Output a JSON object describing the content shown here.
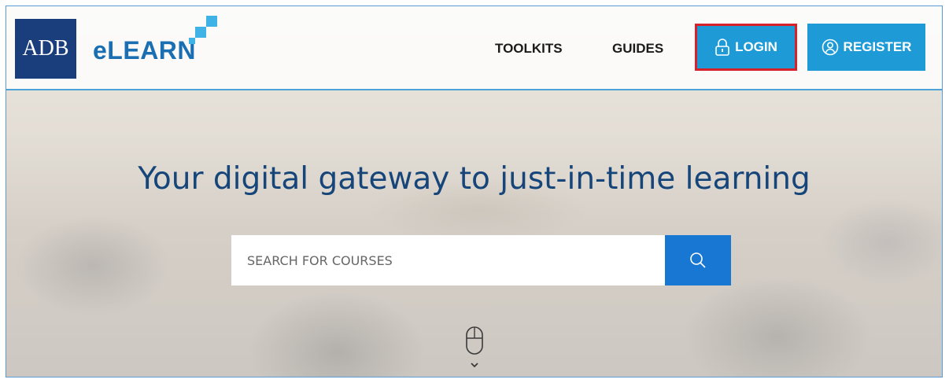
{
  "brand": {
    "logo_text": "ADB",
    "product_name": "eLEARN",
    "logo_bg_color": "#1a3d7c",
    "accent_color": "#3fb3e5"
  },
  "nav": {
    "links": [
      {
        "label": "TOOLKITS"
      },
      {
        "label": "GUIDES"
      }
    ],
    "login": {
      "label": "LOGIN",
      "icon": "lock-icon"
    },
    "register": {
      "label": "REGISTER",
      "icon": "user-circle-icon"
    },
    "button_color": "#1e9bd7",
    "highlight_color": "#d6202a"
  },
  "hero": {
    "headline": "Your digital gateway to just-in-time learning",
    "search": {
      "placeholder": "SEARCH FOR COURSES",
      "button_icon": "search-icon",
      "button_color": "#1877d2"
    },
    "scroll_icon": "mouse-scroll-icon"
  }
}
